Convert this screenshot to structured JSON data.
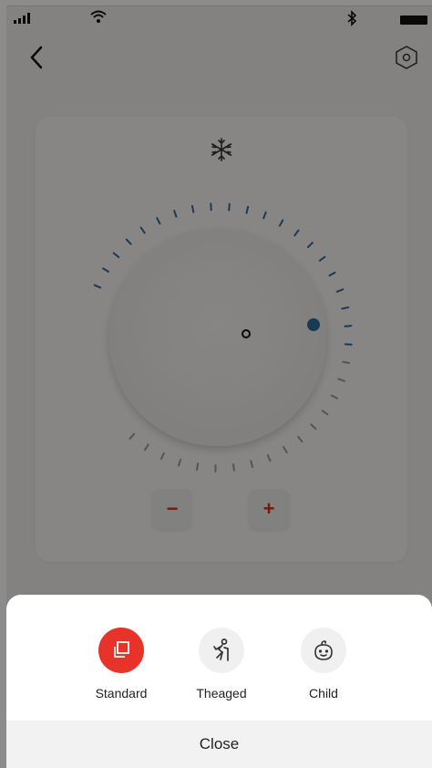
{
  "colors": {
    "accent_red": "#e8332a",
    "tick_blue": "#2f6b9e",
    "overlay": "rgba(0,0,0,0.45)"
  },
  "status_bar": {
    "icons": [
      "signal-icon",
      "wifi-icon",
      "bluetooth-icon",
      "battery-icon"
    ]
  },
  "nav": {
    "back_icon": "chevron-left-icon",
    "settings_icon": "hex-settings-icon"
  },
  "control": {
    "mode_icon": "snowflake-icon",
    "minus_label": "−",
    "plus_label": "+"
  },
  "sheet": {
    "options": [
      {
        "label": "Standard",
        "icon": "standard-mode-icon",
        "active": true
      },
      {
        "label": "Theaged",
        "icon": "elderly-icon",
        "active": false
      },
      {
        "label": "Child",
        "icon": "baby-icon",
        "active": false
      }
    ],
    "close_label": "Close"
  }
}
